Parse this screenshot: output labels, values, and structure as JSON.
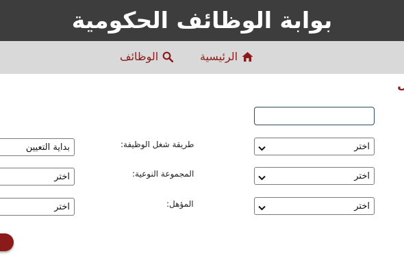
{
  "header": {
    "title": "بوابة الوظائف الحكومية"
  },
  "nav": {
    "home_label": "الرئيسية",
    "jobs_label": "الوظائف",
    "home_icon": "home-icon",
    "search_icon": "search-icon"
  },
  "form": {
    "edge_text": "ل",
    "keyword_value": "",
    "right_column": [
      {
        "selected": "اختر"
      },
      {
        "selected": "اختر"
      },
      {
        "selected": "اختر"
      }
    ],
    "labels": [
      "طريقة شغل الوظيفة:",
      "المجموعة النوعية:",
      "المؤهل:"
    ],
    "left_column": [
      "بداية التعيين",
      "اختر",
      "اختر"
    ]
  },
  "colors": {
    "header_bg": "#3d3d3d",
    "nav_bg": "#d9d9d9",
    "accent": "#8b1a1a"
  }
}
